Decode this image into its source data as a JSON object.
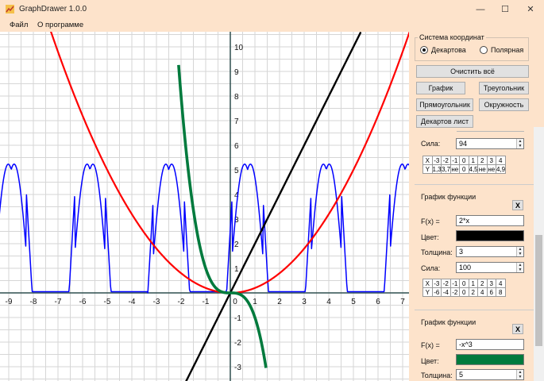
{
  "window": {
    "title": "GraphDrawer 1.0.0",
    "minimize": "—",
    "maximize": "☐",
    "close": "✕",
    "icon": "app-graph-icon"
  },
  "menu": [
    {
      "label": "Файл"
    },
    {
      "label": "О программе"
    }
  ],
  "coords": {
    "group_label": "Система координат",
    "cartesian": "Декартова",
    "polar": "Полярная",
    "selected": "Декартова"
  },
  "buttons": {
    "clear": "Очистить всё",
    "graph": "График",
    "triangle": "Треугольник",
    "rectangle": "Прямоугольник",
    "circle": "Окружность",
    "cartesian_leaf": "Декартов лист"
  },
  "partial_block": {
    "strength_label": "Сила:",
    "strength_value": "94",
    "table": [
      [
        "X",
        "-3",
        "-2",
        "-1",
        "0",
        "1",
        "2",
        "3",
        "4"
      ],
      [
        "Y",
        "1,3",
        "3,7",
        "не",
        "0",
        "4,5",
        "не",
        "не",
        "4,9"
      ]
    ]
  },
  "func1": {
    "title": "График функции",
    "close": "X",
    "fx_label": "F(x) =",
    "fx_value": "2*x",
    "color_label": "Цвет:",
    "color": "#000000",
    "width_label": "Толщина:",
    "width_value": "3",
    "strength_label": "Сила:",
    "strength_value": "100",
    "table": [
      [
        "X",
        "-3",
        "-2",
        "-1",
        "0",
        "1",
        "2",
        "3",
        "4"
      ],
      [
        "Y",
        "-6",
        "-4",
        "-2",
        "0",
        "2",
        "4",
        "6",
        "8"
      ]
    ]
  },
  "func2": {
    "title": "График функции",
    "close": "X",
    "fx_label": "F(x) =",
    "fx_value": "-x^3",
    "color_label": "Цвет:",
    "color": "#007a3d",
    "width_label": "Толщина:",
    "width_value": "5"
  },
  "plot": {
    "x_ticks": [
      "-9",
      "-8",
      "-7",
      "-6",
      "-5",
      "-4",
      "-3",
      "-2",
      "-1",
      "0",
      "1",
      "2",
      "3",
      "4",
      "5",
      "6",
      "7"
    ],
    "y_ticks": [
      "10",
      "9",
      "8",
      "7",
      "6",
      "5",
      "4",
      "3",
      "2",
      "1",
      "-1",
      "-2",
      "-3"
    ],
    "curves": [
      {
        "expr": "x^2/5",
        "color": "#ff0000"
      },
      {
        "expr": "2*x",
        "color": "#000000"
      },
      {
        "expr": "-x^3",
        "color": "#007a3d"
      },
      {
        "expr": "periodic pulses",
        "color": "#0000ff"
      }
    ]
  }
}
